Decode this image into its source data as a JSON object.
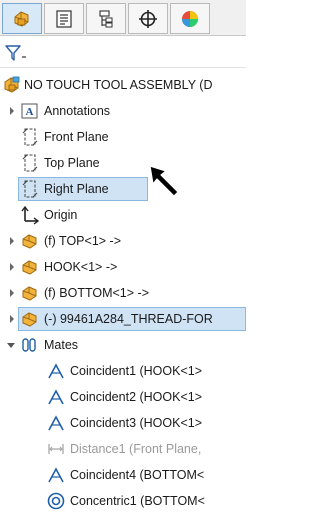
{
  "toolbar": {
    "tabs": [
      {
        "name": "feature-manager-tab",
        "icon": "assembly-tab-icon",
        "active": true
      },
      {
        "name": "property-manager-tab",
        "icon": "property-manager-icon",
        "active": false
      },
      {
        "name": "configuration-manager-tab",
        "icon": "configuration-manager-icon",
        "active": false
      },
      {
        "name": "dimxpert-tab",
        "icon": "dimxpert-icon",
        "active": false
      },
      {
        "name": "display-manager-tab",
        "icon": "display-manager-icon",
        "active": false
      }
    ]
  },
  "filter": {
    "icon": "filter-icon"
  },
  "tree": {
    "root": {
      "label": "NO TOUCH TOOL ASSEMBLY (D"
    },
    "items": [
      {
        "label": "Annotations"
      },
      {
        "label": "Front Plane"
      },
      {
        "label": "Top Plane"
      },
      {
        "label": "Right Plane"
      },
      {
        "label": "Origin"
      },
      {
        "label": "(f) TOP<1> ->"
      },
      {
        "label": "HOOK<1> ->"
      },
      {
        "label": "(f) BOTTOM<1> ->"
      },
      {
        "label": "(-) 99461A284_THREAD-FOR"
      },
      {
        "label": "Mates"
      },
      {
        "label": "Coincident1 (HOOK<1>"
      },
      {
        "label": "Coincident2 (HOOK<1>"
      },
      {
        "label": "Coincident3 (HOOK<1>"
      },
      {
        "label": "Distance1 (Front Plane,"
      },
      {
        "label": "Coincident4 (BOTTOM<"
      },
      {
        "label": "Concentric1 (BOTTOM<"
      }
    ]
  },
  "colors": {
    "selection": "#cfe3f5",
    "part_yellow": "#f2b33d",
    "mate_blue": "#1f5fa8"
  }
}
